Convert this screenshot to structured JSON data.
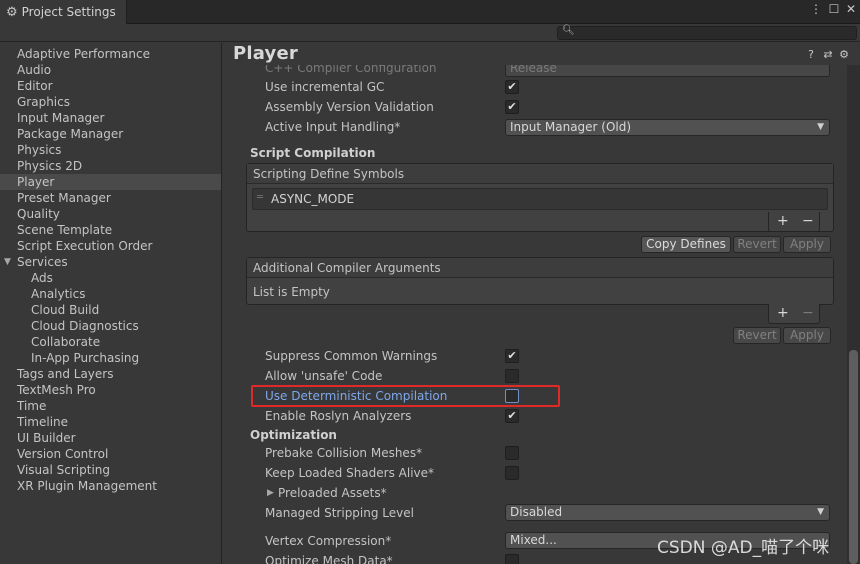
{
  "window": {
    "tab_icon": "gear-icon",
    "tab_title": "Project Settings",
    "menu_icon": "⋮",
    "maximize_icon": "☐",
    "close_icon": "✕"
  },
  "search": {
    "icon": "search-icon",
    "placeholder": ""
  },
  "sidebar": {
    "items": [
      "Adaptive Performance",
      "Audio",
      "Editor",
      "Graphics",
      "Input Manager",
      "Package Manager",
      "Physics",
      "Physics 2D",
      "Player",
      "Preset Manager",
      "Quality",
      "Scene Template",
      "Script Execution Order",
      "Services",
      "Ads",
      "Analytics",
      "Cloud Build",
      "Cloud Diagnostics",
      "Collaborate",
      "In-App Purchasing",
      "Tags and Layers",
      "TextMesh Pro",
      "Time",
      "Timeline",
      "UI Builder",
      "Version Control",
      "Visual Scripting",
      "XR Plugin Management"
    ],
    "selected": "Player"
  },
  "main": {
    "title": "Player",
    "header_icons": [
      "help-icon",
      "preset-icon",
      "settings-icon"
    ],
    "rows": {
      "cpp_config_label": "C++ Compiler Configuration",
      "cpp_config_value": "Release",
      "incremental_gc": "Use incremental GC",
      "assembly_validation": "Assembly Version Validation",
      "active_input": "Active Input Handling*",
      "active_input_value": "Input Manager (Old)"
    },
    "script_compilation": {
      "heading": "Script Compilation",
      "define_symbols_header": "Scripting Define Symbols",
      "define_symbol_value": "ASYNC_MODE",
      "plus": "+",
      "minus": "−",
      "copy_defines": "Copy Defines",
      "revert": "Revert",
      "apply": "Apply",
      "compiler_args_header": "Additional Compiler Arguments",
      "list_empty": "List is Empty"
    },
    "toggles": {
      "suppress_warnings": "Suppress Common Warnings",
      "allow_unsafe": "Allow 'unsafe' Code",
      "deterministic": "Use Deterministic Compilation",
      "roslyn": "Enable Roslyn Analyzers"
    },
    "optimization": {
      "heading": "Optimization",
      "prebake": "Prebake Collision Meshes*",
      "keep_shaders": "Keep Loaded Shaders Alive*",
      "preloaded_assets": "Preloaded Assets*",
      "stripping_level": "Managed Stripping Level",
      "stripping_value": "Disabled",
      "vertex_compression": "Vertex Compression*",
      "vertex_value": "Mixed...",
      "optimize_mesh": "Optimize Mesh Data*"
    },
    "checkbox_states": {
      "incremental_gc": true,
      "assembly_validation": true,
      "suppress_warnings": true,
      "allow_unsafe": false,
      "deterministic": false,
      "roslyn": true,
      "prebake": false,
      "keep_shaders": false,
      "optimize_mesh": false
    },
    "check_glyph": "✔",
    "dropdown_caret": "▼",
    "foldout_arrow": "▶"
  },
  "watermark": "CSDN @AD_喵了个咪",
  "colors": {
    "background": "#383838",
    "highlight_text": "#7ea7ea",
    "annotation_box": "#e02a2a",
    "selected_row": "#4a4a4a"
  }
}
